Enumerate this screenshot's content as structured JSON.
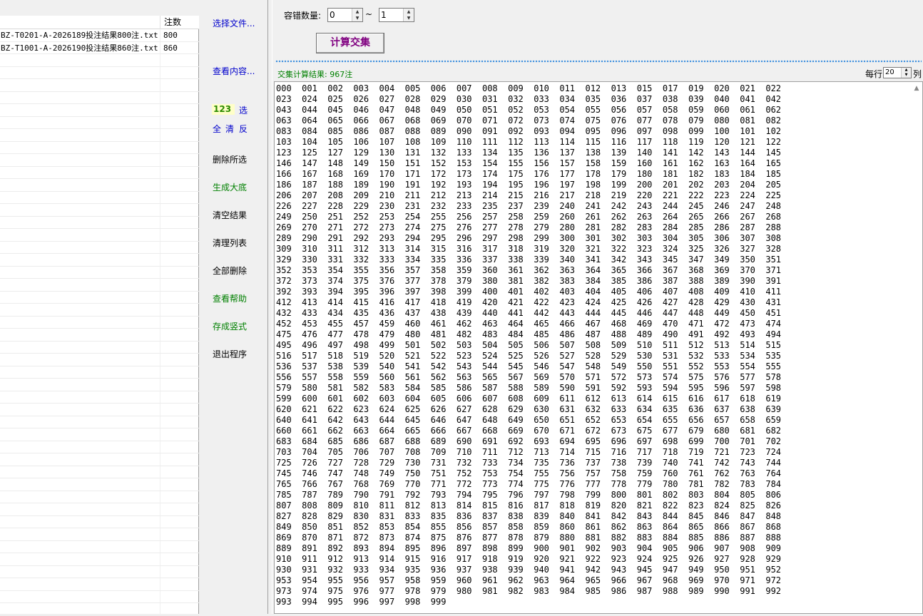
{
  "file_list": {
    "count_header": "注数",
    "files": [
      {
        "name": "BZ-T0201-A-2026189投注结果800注.txt",
        "count": "800"
      },
      {
        "name": "BZ-T1001-A-2026190投注结果860注.txt",
        "count": "860"
      }
    ]
  },
  "commands": {
    "select_file": "选择文件...",
    "view_content": "查看内容...",
    "badge": "123",
    "select": "选",
    "all": "全",
    "clear": "清",
    "invert": "反",
    "delete_selected": "删除所选",
    "generate_base": "生成大底",
    "clear_result": "清空结果",
    "clean_list": "清理列表",
    "delete_all": "全部删除",
    "view_help": "查看帮助",
    "save_vertical": "存成竖式",
    "exit": "退出程序"
  },
  "controls": {
    "tolerance_label": "容错数量:",
    "tol_min": "0",
    "tilde": "~",
    "tol_max": "1",
    "calc_button": "计算交集",
    "result_label": "交集计算结果: 967注",
    "per_row_label": "每行",
    "per_row_value": "20",
    "per_row_unit": "列"
  },
  "result": {
    "lines": [
      "000  001  002  003  004  005  006  007  008  009  010  011  012  013  015  017  019  020  021  022",
      "023  024  025  026  027  028  029  030  031  032  033  034  035  036  037  038  039  040  041  042",
      "043  044  045  046  047  048  049  050  051  052  053  054  055  056  057  058  059  060  061  062",
      "063  064  065  066  067  068  069  070  071  072  073  074  075  076  077  078  079  080  081  082",
      "083  084  085  086  087  088  089  090  091  092  093  094  095  096  097  098  099  100  101  102",
      "103  104  105  106  107  108  109  110  111  112  113  114  115  116  117  118  119  120  121  122",
      "123  125  127  129  130  131  132  133  134  135  136  137  138  139  140  141  142  143  144  145",
      "146  147  148  149  150  151  152  153  154  155  156  157  158  159  160  161  162  163  164  165",
      "166  167  168  169  170  171  172  173  174  175  176  177  178  179  180  181  182  183  184  185",
      "186  187  188  189  190  191  192  193  194  195  196  197  198  199  200  201  202  203  204  205",
      "206  207  208  209  210  211  212  213  214  215  216  217  218  219  220  221  222  223  224  225",
      "226  227  228  229  230  231  232  233  235  237  239  240  241  242  243  244  245  246  247  248",
      "249  250  251  252  253  254  255  256  257  258  259  260  261  262  263  264  265  266  267  268",
      "269  270  271  272  273  274  275  276  277  278  279  280  281  282  283  284  285  286  287  288",
      "289  290  291  292  293  294  295  296  297  298  299  300  301  302  303  304  305  306  307  308",
      "309  310  311  312  313  314  315  316  317  318  319  320  321  322  323  324  325  326  327  328",
      "329  330  331  332  333  334  335  336  337  338  339  340  341  342  343  345  347  349  350  351",
      "352  353  354  355  356  357  358  359  360  361  362  363  364  365  366  367  368  369  370  371",
      "372  373  374  375  376  377  378  379  380  381  382  383  384  385  386  387  388  389  390  391",
      "392  393  394  395  396  397  398  399  400  401  402  403  404  405  406  407  408  409  410  411",
      "412  413  414  415  416  417  418  419  420  421  422  423  424  425  426  427  428  429  430  431",
      "432  433  434  435  436  437  438  439  440  441  442  443  444  445  446  447  448  449  450  451",
      "452  453  455  457  459  460  461  462  463  464  465  466  467  468  469  470  471  472  473  474",
      "475  476  477  478  479  480  481  482  483  484  485  486  487  488  489  490  491  492  493  494",
      "495  496  497  498  499  501  502  503  504  505  506  507  508  509  510  511  512  513  514  515",
      "516  517  518  519  520  521  522  523  524  525  526  527  528  529  530  531  532  533  534  535",
      "536  537  538  539  540  541  542  543  544  545  546  547  548  549  550  551  552  553  554  555",
      "556  557  558  559  560  561  562  563  565  567  569  570  571  572  573  574  575  576  577  578",
      "579  580  581  582  583  584  585  586  587  588  589  590  591  592  593  594  595  596  597  598",
      "599  600  601  602  603  604  605  606  607  608  609  611  612  613  614  615  616  617  618  619",
      "620  621  622  623  624  625  626  627  628  629  630  631  632  633  634  635  636  637  638  639",
      "640  641  642  643  644  645  646  647  648  649  650  651  652  653  654  655  656  657  658  659",
      "660  661  662  663  664  665  666  667  668  669  670  671  672  673  675  677  679  680  681  682",
      "683  684  685  686  687  688  689  690  691  692  693  694  695  696  697  698  699  700  701  702",
      "703  704  705  706  707  708  709  710  711  712  713  714  715  716  717  718  719  721  723  724",
      "725  726  727  728  729  730  731  732  733  734  735  736  737  738  739  740  741  742  743  744",
      "745  746  747  748  749  750  751  752  753  754  755  756  757  758  759  760  761  762  763  764",
      "765  766  767  768  769  770  771  772  773  774  775  776  777  778  779  780  781  782  783  784",
      "785  787  789  790  791  792  793  794  795  796  797  798  799  800  801  802  803  804  805  806",
      "807  808  809  810  811  812  813  814  815  816  817  818  819  820  821  822  823  824  825  826",
      "827  828  829  830  831  833  835  836  837  838  839  840  841  842  843  844  845  846  847  848",
      "849  850  851  852  853  854  855  856  857  858  859  860  861  862  863  864  865  866  867  868",
      "869  870  871  872  873  874  875  876  877  878  879  880  881  882  883  884  885  886  887  888",
      "889  891  892  893  894  895  896  897  898  899  900  901  902  903  904  905  906  907  908  909",
      "910  911  912  913  914  915  916  917  918  919  920  921  922  923  924  925  926  927  928  929",
      "930  931  932  933  934  935  936  937  938  939  940  941  942  943  945  947  949  950  951  952",
      "953  954  955  956  957  958  959  960  961  962  963  964  965  966  967  968  969  970  971  972",
      "973  974  975  976  977  978  979  980  981  982  983  984  985  986  987  988  989  990  991  992",
      "993  994  995  996  997  998  999"
    ]
  }
}
